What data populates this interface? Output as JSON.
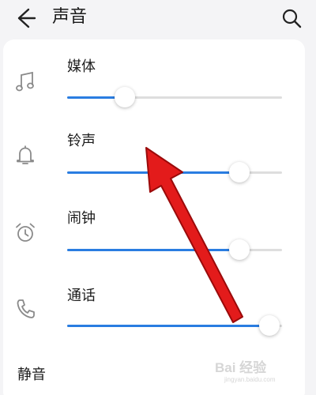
{
  "header": {
    "title": "声音",
    "back_icon": "back-arrow-icon",
    "search_icon": "search-icon"
  },
  "volume_rows": [
    {
      "label": "媒体",
      "icon": "music-note-icon",
      "level": 0.27
    },
    {
      "label": "铃声",
      "icon": "bell-icon",
      "level": 0.8
    },
    {
      "label": "闹钟",
      "icon": "alarm-clock-icon",
      "level": 0.8
    },
    {
      "label": "通话",
      "icon": "phone-icon",
      "level": 0.94
    }
  ],
  "mute": {
    "label": "静音"
  },
  "watermark": {
    "main": "Bai 经验",
    "sub": "jingyan.baidu.com"
  },
  "colors": {
    "accent": "#2a7de1",
    "track": "#dedede",
    "annotation_arrow": "#e31b1b",
    "background": "#f4f4f6",
    "card": "#ffffff"
  }
}
